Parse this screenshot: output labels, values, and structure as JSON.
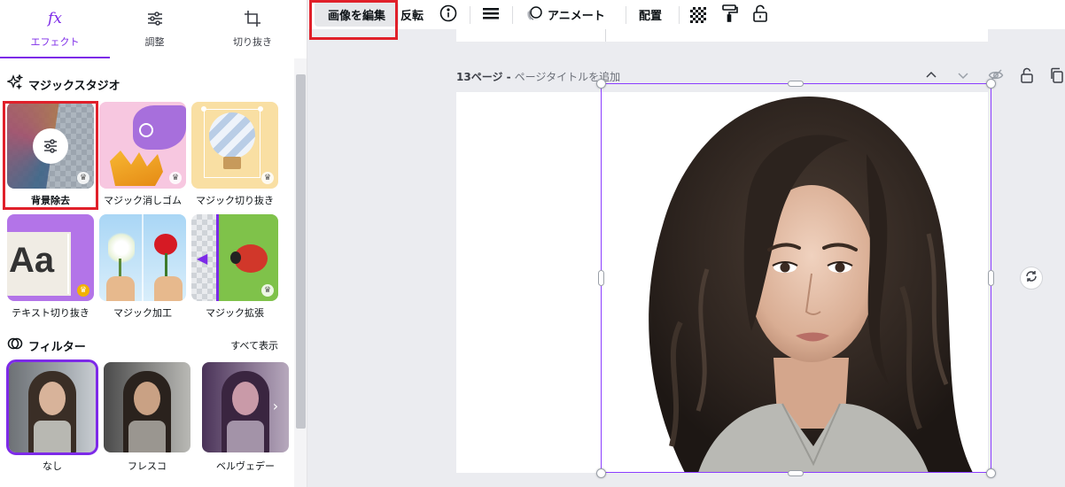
{
  "panel": {
    "tabs": [
      {
        "label": "エフェクト",
        "icon": "fx-icon",
        "active": true
      },
      {
        "label": "調整",
        "icon": "sliders-icon",
        "active": false
      },
      {
        "label": "切り抜き",
        "icon": "crop-icon",
        "active": false
      }
    ],
    "magic_studio": {
      "title": "マジックスタジオ",
      "icon": "sparkle-icon",
      "tiles": [
        {
          "label": "背景除去",
          "highlighted": true,
          "premium": true
        },
        {
          "label": "マジック消しゴム",
          "premium": true
        },
        {
          "label": "マジック切り抜き",
          "premium": true
        },
        {
          "label": "テキスト切り抜き",
          "premium": true
        },
        {
          "label": "マジック加工",
          "premium": false
        },
        {
          "label": "マジック拡張",
          "premium": true
        }
      ],
      "tile_text": "Aa"
    },
    "filters": {
      "title": "フィルター",
      "icon": "filter-icon",
      "see_all": "すべて表示",
      "items": [
        {
          "label": "なし",
          "selected": true
        },
        {
          "label": "フレスコ",
          "selected": false
        },
        {
          "label": "ベルヴェデー",
          "selected": false
        }
      ]
    }
  },
  "toolbar": {
    "edit_image": "画像を編集",
    "flip": "反転",
    "animate": "アニメート",
    "position": "配置"
  },
  "canvas": {
    "page_number": "13ページ -",
    "page_title_placeholder": "ページタイトルを追加"
  },
  "colors": {
    "accent": "#7d2ae8",
    "selection": "#8b3dff",
    "highlight": "#e0202a"
  }
}
